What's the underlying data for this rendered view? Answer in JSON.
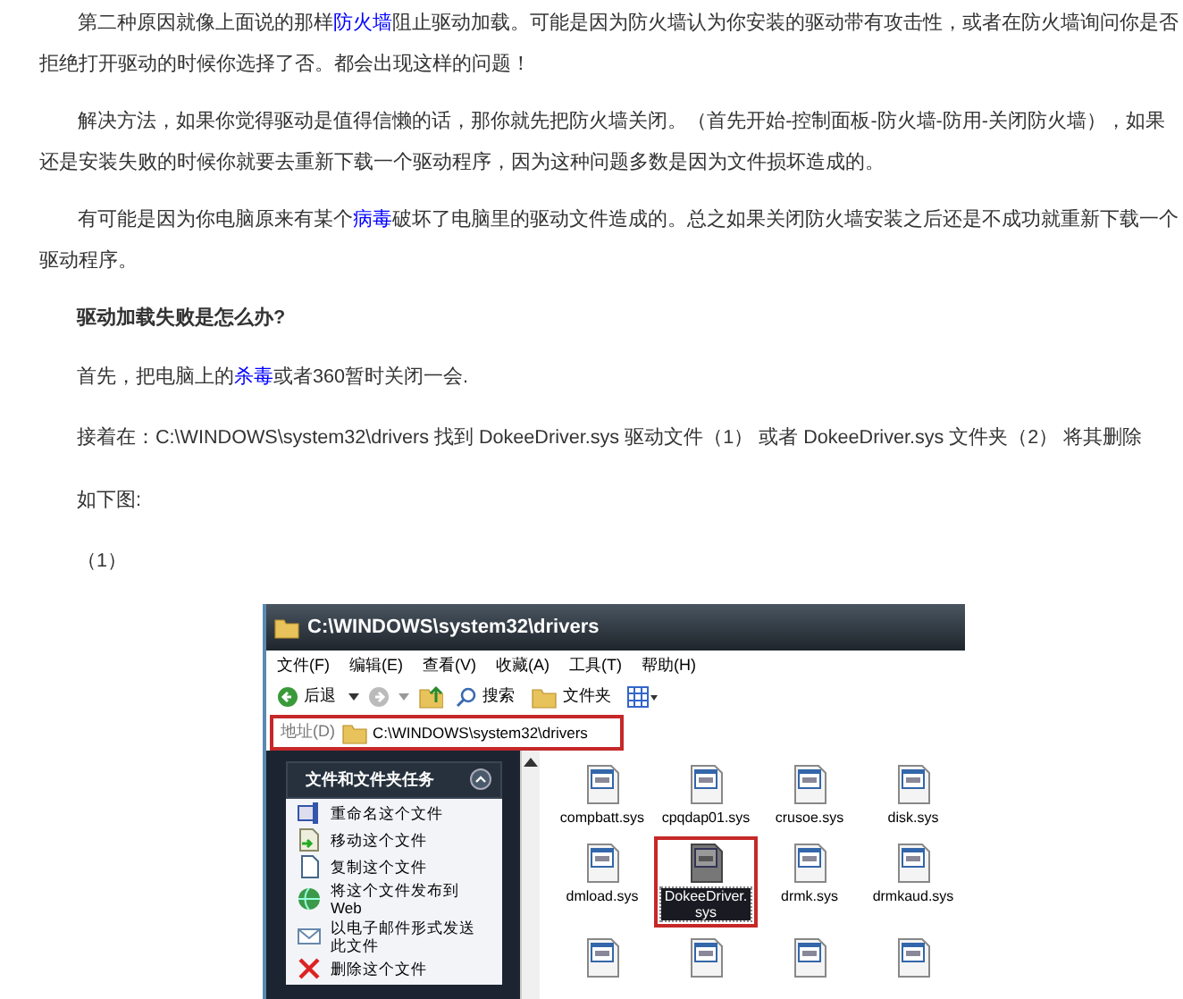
{
  "article": {
    "paragraphs": [
      {
        "kind": "indent",
        "parts": [
          {
            "text": "第二种原因就像上面说的那样",
            "kind": "text"
          },
          {
            "text": "防火墙",
            "kind": "link"
          },
          {
            "text": "阻止驱动加载。可能是因为防火墙认为你安装的驱动带有攻击性，或者在防火墙询问你是否拒绝打开驱动的时候你选择了否。都会出现这样的问题！",
            "kind": "text"
          }
        ]
      },
      {
        "kind": "indent",
        "parts": [
          {
            "text": "解决方法，如果你觉得驱动是值得信懒的话，那你就先把防火墙关闭。（首先开始-控制面板-防火墙-防用-关闭防火墙），如果还是安装失败的时候你就要去重新下载一个驱动程序，因为这种问题多数是因为文件损坏造成的。",
            "kind": "text"
          }
        ]
      },
      {
        "kind": "indent",
        "parts": [
          {
            "text": "有可能是因为你电脑原来有某个",
            "kind": "text"
          },
          {
            "text": "病毒",
            "kind": "link"
          },
          {
            "text": "破坏了电脑里的驱动文件造成的。总之如果关闭防火墙安装之后还是不成功就重新下载一个驱动程序。",
            "kind": "text"
          }
        ]
      },
      {
        "kind": "heading",
        "parts": [
          {
            "text": "驱动加载失败是怎么办?",
            "kind": "text"
          }
        ]
      },
      {
        "kind": "block",
        "parts": [
          {
            "text": "首先，把电脑上的",
            "kind": "text"
          },
          {
            "text": "杀毒",
            "kind": "link"
          },
          {
            "text": "或者360暂时关闭一会.",
            "kind": "text"
          }
        ]
      },
      {
        "kind": "block",
        "parts": [
          {
            "text": "接着在：C:\\WINDOWS\\system32\\drivers 找到 DokeeDriver.sys 驱动文件（1） 或者 DokeeDriver.sys 文件夹（2） 将其删除",
            "kind": "text"
          }
        ]
      },
      {
        "kind": "block",
        "parts": [
          {
            "text": "如下图:",
            "kind": "text"
          }
        ]
      },
      {
        "kind": "block",
        "parts": [
          {
            "text": "（1）",
            "kind": "text"
          }
        ]
      }
    ]
  },
  "explorer": {
    "title": "C:\\WINDOWS\\system32\\drivers",
    "menu": [
      "文件(F)",
      "编辑(E)",
      "查看(V)",
      "收藏(A)",
      "工具(T)",
      "帮助(H)"
    ],
    "toolbar": {
      "back": "后退",
      "search": "搜索",
      "folders": "文件夹"
    },
    "address": {
      "label": "地址(D)",
      "value": "C:\\WINDOWS\\system32\\drivers",
      "highlighted": true
    },
    "tasks": {
      "title": "文件和文件夹任务",
      "items": [
        {
          "kind": "rename",
          "label": "重命名这个文件"
        },
        {
          "kind": "move",
          "label": "移动这个文件"
        },
        {
          "kind": "copy",
          "label": "复制这个文件"
        },
        {
          "kind": "publish",
          "label": "将这个文件发布到 Web"
        },
        {
          "kind": "email",
          "label": "以电子邮件形式发送此文件"
        },
        {
          "kind": "delete",
          "label": "删除这个文件"
        }
      ]
    },
    "files": [
      {
        "name": "compbatt.sys",
        "selected": false,
        "highlighted": false
      },
      {
        "name": "cpqdap01.sys",
        "selected": false,
        "highlighted": false
      },
      {
        "name": "crusoe.sys",
        "selected": false,
        "highlighted": false
      },
      {
        "name": "disk.sys",
        "selected": false,
        "highlighted": false
      },
      {
        "name": "dmload.sys",
        "selected": false,
        "highlighted": false
      },
      {
        "name": "DokeeDriver.sys",
        "selected": true,
        "highlighted": true
      },
      {
        "name": "drmk.sys",
        "selected": false,
        "highlighted": false
      },
      {
        "name": "drmkaud.sys",
        "selected": false,
        "highlighted": false
      }
    ]
  }
}
